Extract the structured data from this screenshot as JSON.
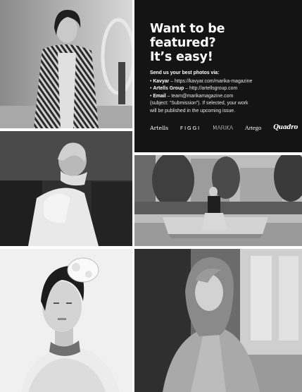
{
  "panel": {
    "headline": [
      "Want to be",
      "featured?",
      "It’s easy!"
    ],
    "lead": "Send us your best photos via:",
    "lines": [
      {
        "bullet": "• ",
        "label": "Kavyar",
        "rest": " – https://kavyar.com/marika-magazine"
      },
      {
        "bullet": "• ",
        "label": "Artells Group",
        "rest": " – http://artellsgroup.com"
      },
      {
        "bullet": "• ",
        "label": "Email",
        "rest": " – team@marikamagazine.com"
      },
      {
        "bullet": "",
        "label": "",
        "rest": "(subject: “Submission”). If selected, your work"
      },
      {
        "bullet": "",
        "label": "",
        "rest": "will be published in the upcoming issue."
      }
    ],
    "logos": [
      "Artells",
      "FIGGI",
      "MARIKA",
      "Artego",
      "Quadro"
    ]
  },
  "photos": [
    {
      "name": "photo-woman-striped-blazer",
      "tone": "#9a9a9a"
    },
    {
      "name": "photo-woman-white-shirt-sofa",
      "tone": "#3a3a3a"
    },
    {
      "name": "photo-woman-sitting-bench",
      "tone": "#8c8c8c"
    },
    {
      "name": "photo-woman-headpiece-fur",
      "tone": "#e6e6e6"
    },
    {
      "name": "photo-woman-coat-wall",
      "tone": "#5a5a5a"
    }
  ]
}
